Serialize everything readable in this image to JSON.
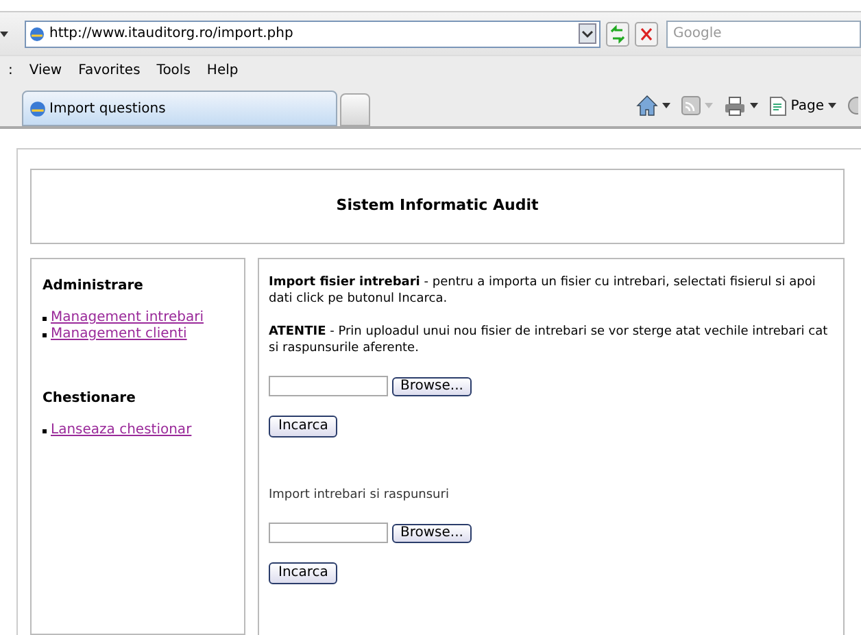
{
  "browser": {
    "address": "http://www.itauditorg.ro/import.php",
    "search": {
      "placeholder": "Google"
    },
    "menu": [
      ":",
      "View",
      "Favorites",
      "Tools",
      "Help"
    ],
    "tabs": [
      {
        "label": "Import questions",
        "selected": true
      },
      {
        "selected": false
      }
    ],
    "toolbar": [
      {
        "kind": "home",
        "disabled": false
      },
      {
        "kind": "feed",
        "disabled": true
      },
      {
        "kind": "print",
        "disabled": false
      },
      {
        "kind": "page",
        "label": "Page",
        "disabled": false
      }
    ]
  },
  "page": {
    "title": "Sistem Informatic Audit",
    "sidebar": [
      {
        "heading": "Administrare",
        "links": [
          "Management intrebari",
          "Management clienti"
        ]
      },
      {
        "heading": "Chestionare",
        "links": [
          "Lanseaza chestionar"
        ]
      }
    ],
    "sections": [
      {
        "intro": "**Import fisier intrebari** - pentru a importa un fisier cu intrebari, selectati fisierul si apoi dati click pe butonul Incarca.",
        "warning": "**ATENTIE** - Prin uploadul unui nou fisier de intrebari se vor sterge atat vechile intrebari cat si raspunsurile aferente.",
        "browse": "Browse...",
        "submit": "Incarca"
      },
      {
        "intro": "Import intrebari si raspunsuri",
        "browse": "Browse...",
        "submit": "Incarca"
      }
    ]
  }
}
